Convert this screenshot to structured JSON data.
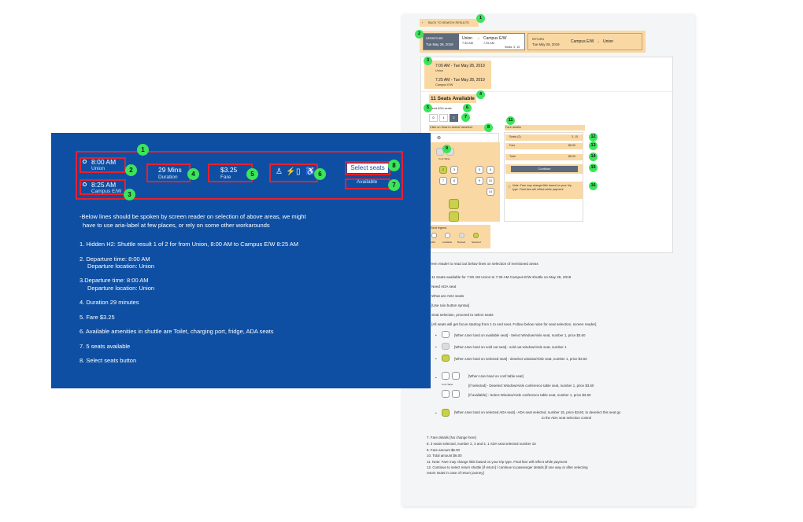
{
  "right_doc": {
    "back_link": "BACK TO SEARCH RESULTS",
    "departure": {
      "label": "DEPARTURE",
      "date": "Tue May 28, 2019",
      "from": "Union",
      "to": "Campus E/W",
      "time_from": "7:30 AM",
      "time_to": "7:25 AM",
      "seats": "Seats: 3, 15"
    },
    "return": {
      "label": "RETURN",
      "date": "Tue May 28, 2019",
      "from": "Campus E/W",
      "to": "Union"
    },
    "trip": {
      "depart_time": "7:00 AM - Tue May 28, 2019",
      "depart_loc": "Union",
      "arrive_time": "7:25 AM - Tue May 28, 2019",
      "arrive_loc": "Campus E/W"
    },
    "seats_available": "11 Seats Available",
    "need_ada": "Need ADA seats",
    "seat_counts": [
      "0",
      "1",
      "2"
    ],
    "click_seat": "Click on Seat to select/ deselect",
    "fare_details": "Fare details",
    "conf_table": "Conf Table",
    "fare_rows": [
      {
        "label": "Seats (2)",
        "value": "3, 15"
      },
      {
        "label": "Fare",
        "value": "$6.00"
      },
      {
        "label": "Total",
        "value": "$6.00"
      }
    ],
    "continue": "Continue",
    "note": "Note: Fare may change little based on your trip type. Final fare will reflect while payment",
    "legend_title": "Seat legend",
    "legend": [
      "ADA",
      "Available",
      "Booked",
      "Selected"
    ],
    "instructions": [
      "Screen reader to read out below lines on selection of mentioned areas",
      "11 Seats available for 7:00 AM Union to 7:25 AM Campus E/W shuttle on May 28, 2019",
      "Need ADA seat",
      "What are ADA seats",
      "[Use raio button syntax]",
      "Seat selection, proceed to select seats",
      "[All seats will get focus starting from 1 to end seat. Follow below rules for seat selection, screen reader]"
    ],
    "seat_rules": [
      "[When User land on available seat] - Select Window/Aisle seat, number 1, price $3.60",
      "[When User land on sold out seat] - sold out window/Aisle seat, number 1",
      "[When User land on selected seat] - deselect window/Aisle seat, number 1, price $3.60"
    ],
    "conf_rules": [
      "[When User land on conf table seat]",
      "[If selected] - Deselect Window/Aisle conference table seat, number 1, price $3.60",
      "[If available] - Select Window/Aisle conference table seat, number 1, price $3.60"
    ],
    "ada_rule": "[When User land on selected ADA seat] - ADA seat selected, number 15, price $3.60, to deselect this seat go",
    "ada_rule2": "to the ADA seat selection control",
    "footer": [
      "7. Fare details (No change here)",
      "8. 3 seats selected, number 2, 3 and 4, 1 ADA seat selected number 15",
      "9. Fare amount $6.00",
      "10. Total amount $6.00",
      "11. Note: Fare may change little based on your trip type. Final fare will reflect while payment",
      "12. Continue to select return shuttle [if return] / continue to passenger details [if one way or after selecting",
      "return seats in case of return journey]"
    ]
  },
  "slide": {
    "depart_time": "8:00 AM",
    "depart_loc": "Union",
    "arrive_time": "8:25 AM",
    "arrive_loc": "Campus E/W",
    "duration": "29 Mins",
    "duration_label": "Duration",
    "fare": "$3.25",
    "fare_label": "Fare",
    "select_seats": "Select seats",
    "available": "Available",
    "intro1": "-Below lines should be spoken by screen reader on selection of above areas, we might",
    "intro2": "have to use aria-label at few places, or rely on some other workarounds",
    "items": [
      "1. Hidden H2: Shuttle result 1 of 2 for from Union, 8:00 AM to Campus E/W 8:25 AM",
      "2. Departure time: 8:00 AM",
      "Departure location: Union",
      "3.Departure time: 8:00 AM",
      "Departure location: Union",
      "4. Duration 29 minutes",
      "5. Fare $3.25",
      "6. Available amenities in shuttle are Toilet, charging port, fridge, ADA seats",
      "7. 5 seats available",
      "8. Select seats button"
    ]
  }
}
